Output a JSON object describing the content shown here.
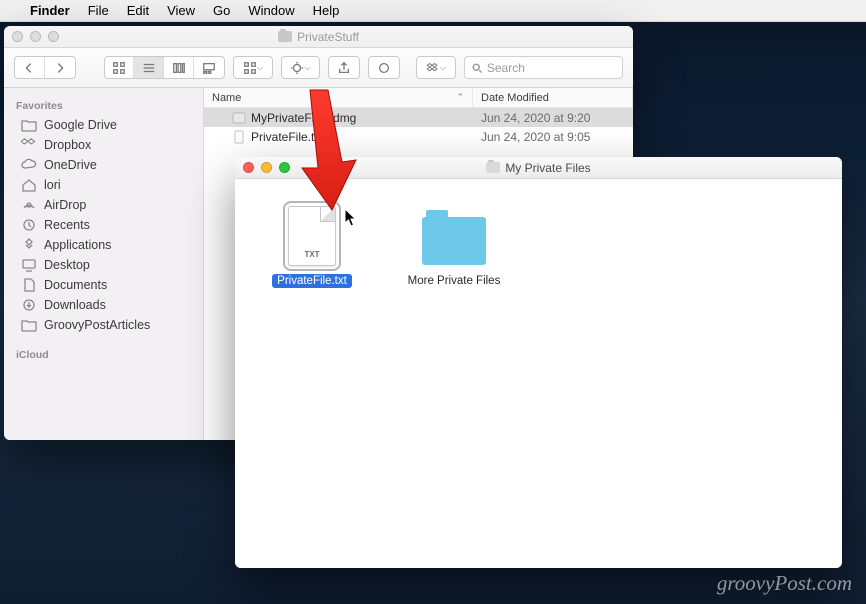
{
  "menubar": {
    "app": "Finder",
    "items": [
      "File",
      "Edit",
      "View",
      "Go",
      "Window",
      "Help"
    ]
  },
  "window1": {
    "title": "PrivateStuff",
    "search_placeholder": "Search",
    "columns": {
      "name": "Name",
      "date": "Date Modified"
    },
    "rows": [
      {
        "name": "MyPrivateFiles.dmg",
        "date": "Jun 24, 2020 at 9:20",
        "selected": true,
        "kind": "dmg"
      },
      {
        "name": "PrivateFile.txt",
        "date": "Jun 24, 2020 at 9:05",
        "selected": false,
        "kind": "txt"
      }
    ],
    "sidebar": {
      "favorites_label": "Favorites",
      "favorites": [
        {
          "label": "Google Drive",
          "icon": "folder"
        },
        {
          "label": "Dropbox",
          "icon": "dropbox"
        },
        {
          "label": "OneDrive",
          "icon": "cloud"
        },
        {
          "label": "lori",
          "icon": "home"
        },
        {
          "label": "AirDrop",
          "icon": "airdrop"
        },
        {
          "label": "Recents",
          "icon": "clock"
        },
        {
          "label": "Applications",
          "icon": "apps"
        },
        {
          "label": "Desktop",
          "icon": "desktop"
        },
        {
          "label": "Documents",
          "icon": "doc"
        },
        {
          "label": "Downloads",
          "icon": "download"
        },
        {
          "label": "GroovyPostArticles",
          "icon": "folder"
        }
      ],
      "icloud_label": "iCloud"
    }
  },
  "window2": {
    "title": "My Private Files",
    "items": [
      {
        "label": "PrivateFile.txt",
        "kind": "txt",
        "ext": "TXT",
        "selected": true
      },
      {
        "label": "More Private Files",
        "kind": "folder",
        "selected": false
      }
    ]
  },
  "watermark": "groovyPost.com"
}
